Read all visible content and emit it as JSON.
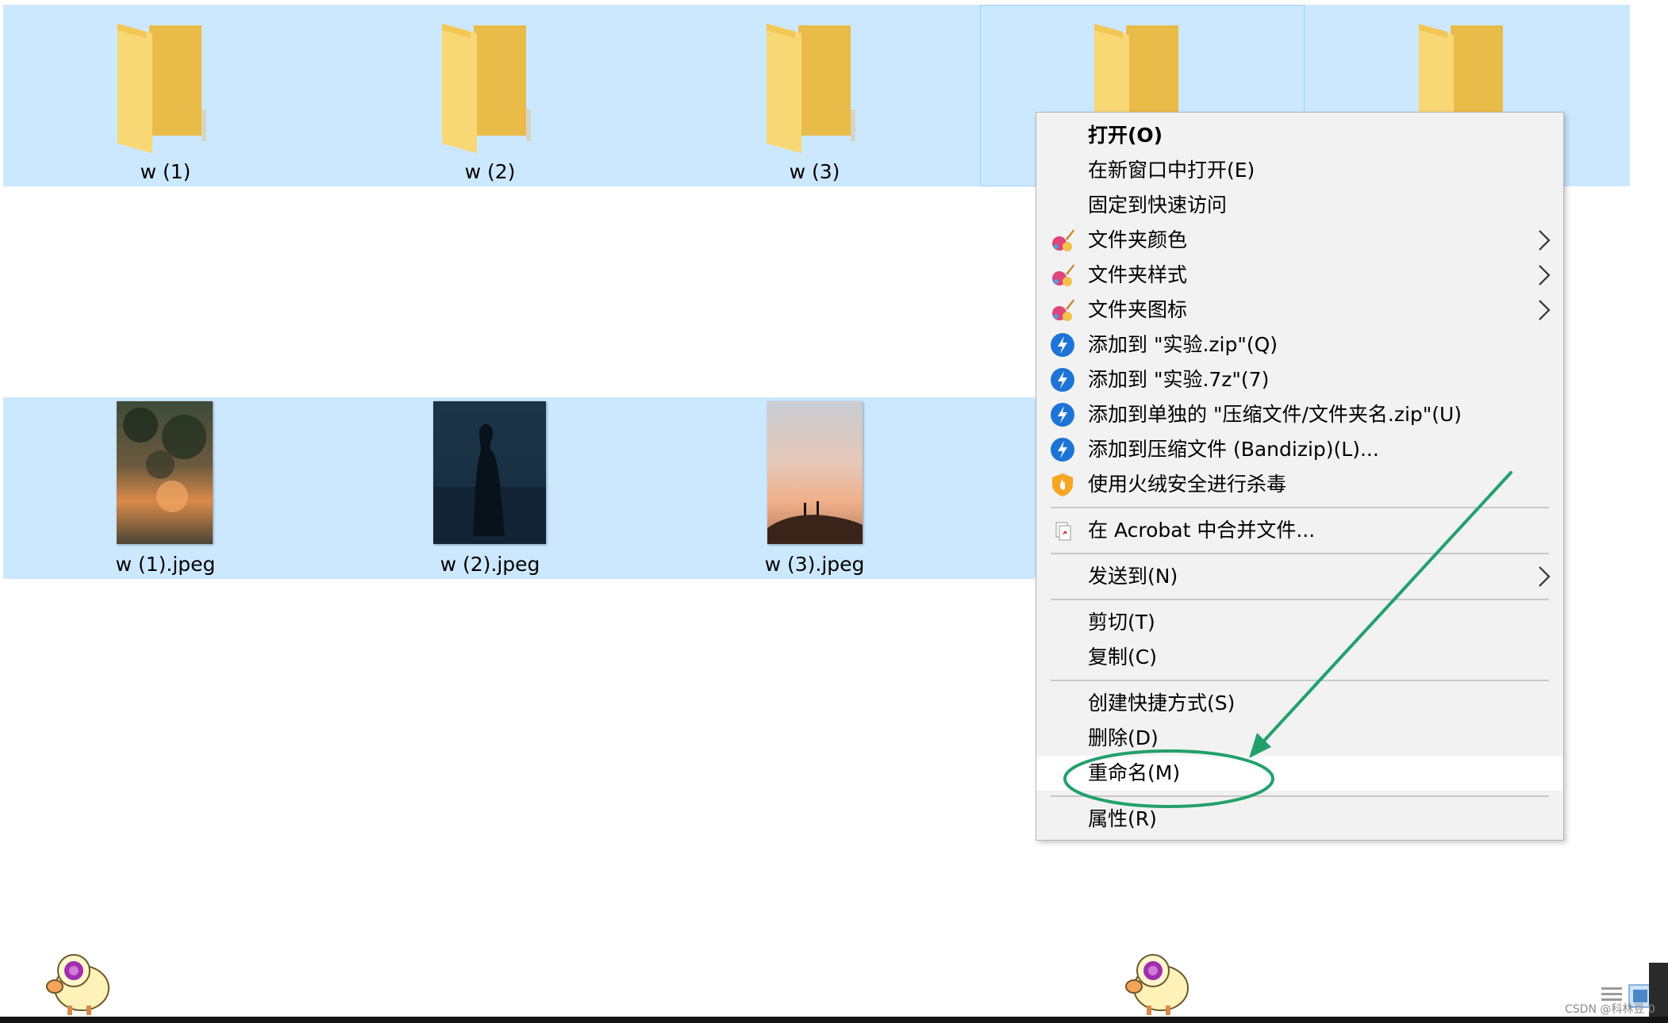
{
  "files": [
    {
      "name": "w (1)",
      "type": "folder"
    },
    {
      "name": "w (2)",
      "type": "folder"
    },
    {
      "name": "w (3)",
      "type": "folder"
    },
    {
      "name": "",
      "type": "folder"
    },
    {
      "name": "",
      "type": "folder"
    },
    {
      "name": "w (1).jpeg",
      "type": "image"
    },
    {
      "name": "w (2).jpeg",
      "type": "image"
    },
    {
      "name": "w (3).jpeg",
      "type": "image"
    }
  ],
  "context_menu": {
    "open": "打开(O)",
    "open_new_window": "在新窗口中打开(E)",
    "pin_quick_access": "固定到快速访问",
    "folder_color": "文件夹颜色",
    "folder_style": "文件夹样式",
    "folder_icon": "文件夹图标",
    "add_zip": "添加到 \"实验.zip\"(Q)",
    "add_7z": "添加到 \"实验.7z\"(7)",
    "add_separate": "添加到单独的 \"压缩文件/文件夹名.zip\"(U)",
    "add_archive": "添加到压缩文件 (Bandizip)(L)...",
    "scan_virus": "使用火绒安全进行杀毒",
    "acrobat_merge": "在 Acrobat 中合并文件...",
    "send_to": "发送到(N)",
    "cut": "剪切(T)",
    "copy": "复制(C)",
    "create_shortcut": "创建快捷方式(S)",
    "delete": "删除(D)",
    "rename": "重命名(M)",
    "properties": "属性(R)"
  },
  "icons": {
    "folder": "folder-icon",
    "paint": "paint-brush-icon",
    "bandizip": "bandizip-icon",
    "huorong": "huorong-shield-icon",
    "acrobat": "acrobat-icon",
    "submenu": "chevron-right-icon"
  },
  "colors": {
    "selection": "#cce8ff",
    "menu_bg": "#f2f2f2",
    "annotation": "#22a06b",
    "folder": "#f8d775"
  },
  "watermark": "CSDN @科林豆 0"
}
